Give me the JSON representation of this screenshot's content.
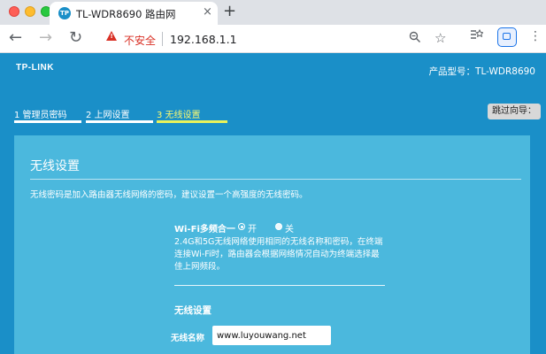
{
  "browser": {
    "tab": {
      "favicon_text": "TP",
      "title": "TL-WDR8690 路由网",
      "close": "×"
    },
    "new_tab": "+",
    "toolbar": {
      "back": "←",
      "forward": "→",
      "reload": "↻",
      "security_label": "不安全",
      "url": "192.168.1.1",
      "zoom_icon": "zoom-icon",
      "bookmark_icon": "star-icon",
      "menu": "⋮"
    }
  },
  "header": {
    "logo": "TP-LINK",
    "model": "产品型号：TL-WDR8690"
  },
  "wizard": {
    "steps": [
      {
        "label": "1 管理员密码",
        "state": "done"
      },
      {
        "label": "2 上网设置",
        "state": "done"
      },
      {
        "label": "3 无线设置",
        "state": "active"
      }
    ],
    "skip_label": "跳过向导："
  },
  "panel": {
    "title": "无线设置",
    "description": "无线密码是加入路由器无线网络的密码，建议设置一个高强度的无线密码。",
    "wifi_merge": {
      "label": "Wi-Fi多频合一",
      "options": [
        {
          "label": "开",
          "selected": true
        },
        {
          "label": "关",
          "selected": false
        }
      ]
    },
    "note": "2.4G和5G无线网络使用相同的无线名称和密码，在终端连接Wi-Fi时，路由器会根据网络情况自动为终端选择最佳上网频段。",
    "section_title": "无线设置",
    "ssid": {
      "label": "无线名称",
      "value": "www.luyouwang.net"
    }
  },
  "colors": {
    "page_bg": "#1a8fc8",
    "panel_bg": "#4bb8dd",
    "active_step": "#e8f25a",
    "insecure": "#d93025"
  }
}
